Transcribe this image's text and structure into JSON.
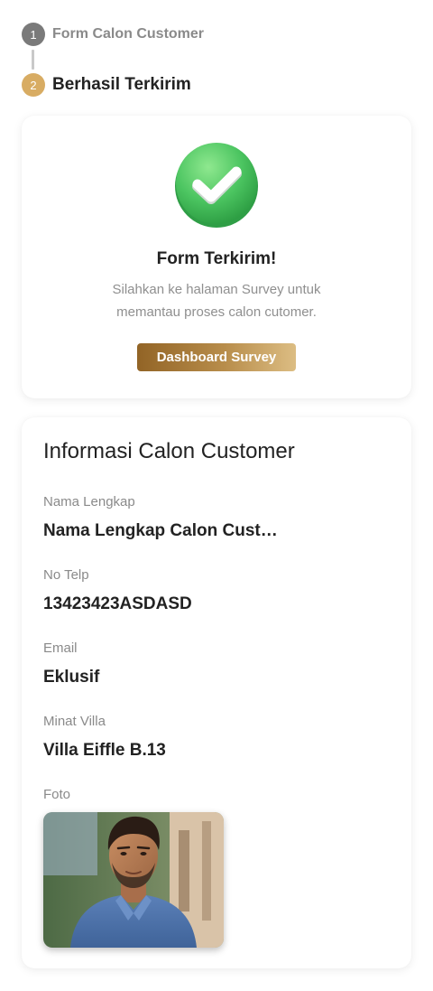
{
  "stepper": {
    "steps": [
      {
        "number": "1",
        "label": "Form Calon Customer",
        "state": "done"
      },
      {
        "number": "2",
        "label": "Berhasil Terkirim",
        "state": "active"
      }
    ]
  },
  "success": {
    "icon": "check-circle-icon",
    "title": "Form Terkirim!",
    "description": "Silahkan ke halaman Survey  untuk memantau proses calon cutomer.",
    "button_label": "Dashboard Survey"
  },
  "info": {
    "title": "Informasi Calon Customer",
    "fields": [
      {
        "label": "Nama Lengkap",
        "value": "Nama Lengkap Calon Cust…"
      },
      {
        "label": "No Telp",
        "value": "13423423ASDASD"
      },
      {
        "label": "Email",
        "value": "Eklusif"
      },
      {
        "label": "Minat Villa",
        "value": "Villa Eiffle B.13"
      }
    ],
    "photo_label": "Foto"
  },
  "colors": {
    "accent": "#d8ac63",
    "step_done": "#7a7a7a",
    "success_green": "#4cc561",
    "button_gradient_start": "#926426",
    "button_gradient_end": "#dcbd83"
  }
}
